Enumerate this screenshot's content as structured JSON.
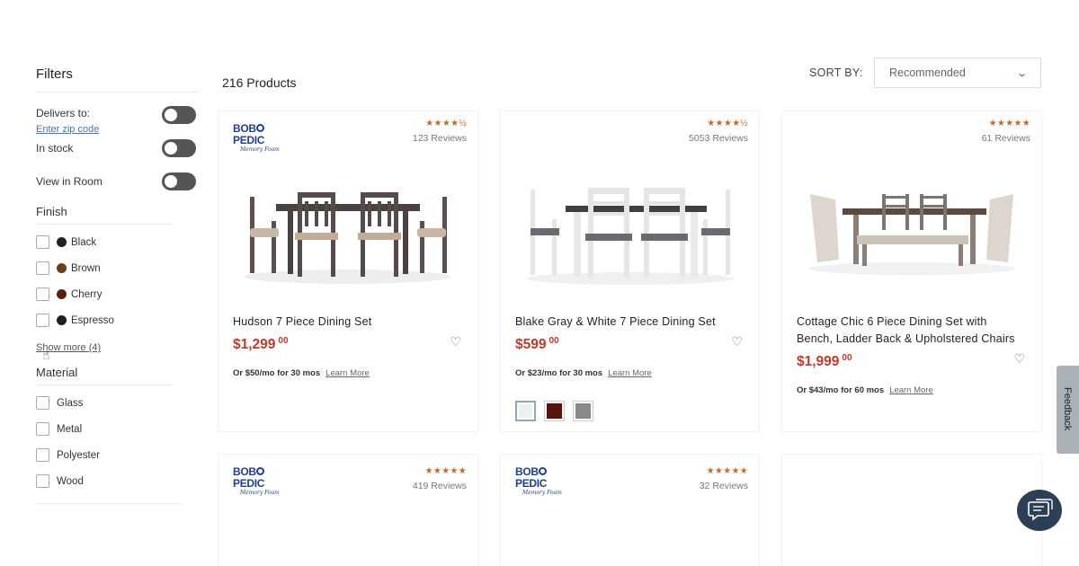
{
  "filters": {
    "title": "Filters",
    "delivers_to_label": "Delivers to:",
    "zip_link": "Enter zip code",
    "in_stock_label": "In stock",
    "view_in_room_label": "View in Room",
    "finish_title": "Finish",
    "finish_options": [
      {
        "label": "Black",
        "color": "#222222"
      },
      {
        "label": "Brown",
        "color": "#6b3e1e"
      },
      {
        "label": "Cherry",
        "color": "#5a1f12"
      },
      {
        "label": "Espresso",
        "color": "#1e1e1e"
      }
    ],
    "show_more": "Show more (4)",
    "material_title": "Material",
    "material_options": [
      "Glass",
      "Metal",
      "Polyester",
      "Wood"
    ]
  },
  "main": {
    "product_count": "216 Products",
    "sort_label": "SORT BY:",
    "sort_value": "Recommended"
  },
  "products": [
    {
      "brand": "BOBOPEDIC",
      "brand_tagline": "Memory Foam",
      "stars": "★★★★½",
      "reviews": "123 Reviews",
      "name": "Hudson 7 Piece Dining Set",
      "price": "$1,299",
      "cents": "00",
      "finance": "Or $50/mo for 30 mos",
      "learn": "Learn More"
    },
    {
      "brand": "",
      "stars": "★★★★½",
      "reviews": "5053 Reviews",
      "name": "Blake Gray & White 7 Piece Dining Set",
      "price": "$599",
      "cents": "00",
      "finance": "Or $23/mo for 30 mos",
      "learn": "Learn More",
      "swatches": [
        "#eef0f0",
        "#5a1410",
        "#8a8a8a"
      ]
    },
    {
      "brand": "",
      "stars": "★★★★★",
      "reviews": "61 Reviews",
      "name_line1": "Cottage Chic 6 Piece Dining Set with",
      "name_line2": "Bench, Ladder Back & Upholstered Chairs",
      "price": "$1,999",
      "cents": "00",
      "finance": "Or $43/mo for 60 mos",
      "learn": "Learn More"
    },
    {
      "brand": "BOBOPEDIC",
      "brand_tagline": "Memory Foam",
      "stars": "★★★★★",
      "reviews": "419 Reviews"
    },
    {
      "brand": "BOBOPEDIC",
      "brand_tagline": "Memory Foam",
      "stars": "★★★★★",
      "reviews": "32 Reviews"
    }
  ],
  "feedback_label": "Feedback",
  "colors": {
    "price": "#c0392b",
    "star": "#c46a2d",
    "brand": "#1f3e8c"
  }
}
